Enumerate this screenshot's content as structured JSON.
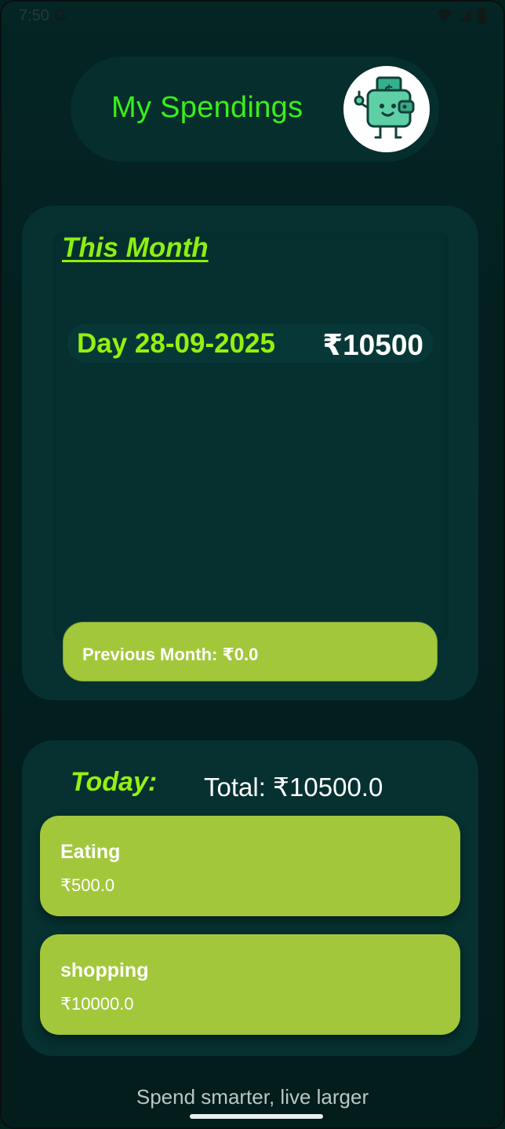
{
  "status_bar": {
    "time": "7:50",
    "google_glyph": "G",
    "icons": [
      "wifi-icon",
      "signal-icon",
      "battery-icon"
    ]
  },
  "header": {
    "title": "My Spendings",
    "logo": "wallet-mascot-icon"
  },
  "month_card": {
    "heading": "This Month",
    "days": [
      {
        "label": "Day 28-09-2025",
        "amount": "₹10500"
      }
    ],
    "previous_month_label": "Previous Month: ₹0.0"
  },
  "today_card": {
    "heading": "Today:",
    "total": "Total: ₹10500.0",
    "expenses": [
      {
        "name": "Eating",
        "amount": "₹500.0"
      },
      {
        "name": "shopping",
        "amount": "₹10000.0"
      }
    ]
  },
  "tagline": "Spend smarter, live larger",
  "colors": {
    "background": "#03201f",
    "card": "#063130",
    "accent_green": "#39f01a",
    "lime": "#a3c73a"
  }
}
